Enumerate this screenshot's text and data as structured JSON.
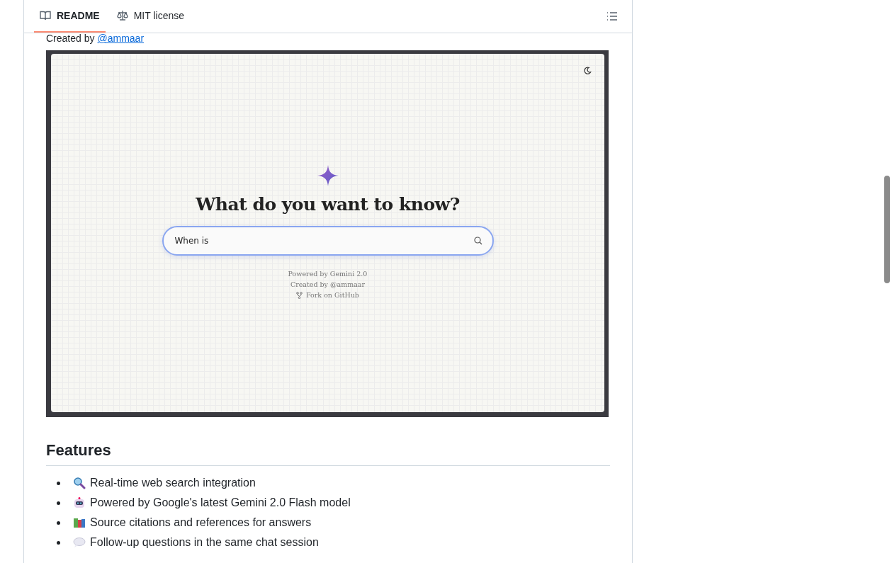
{
  "tabs": [
    {
      "label": "README",
      "selected": true
    },
    {
      "label": "MIT license",
      "selected": false
    }
  ],
  "created_by": {
    "text": "Created by",
    "link": "@ammaar"
  },
  "app_preview": {
    "heading": "What do you want to know?",
    "search_value": "When is",
    "footer": [
      "Powered by Gemini 2.0",
      "Created by @ammaar"
    ],
    "fork_link": "Fork on GitHub"
  },
  "features": {
    "heading": "Features",
    "items": [
      {
        "kind": "search",
        "text": "Real-time web search integration"
      },
      {
        "kind": "robot",
        "text": "Powered by Google's latest Gemini 2.0 Flash model"
      },
      {
        "kind": "books",
        "text": "Source citations and references for answers"
      },
      {
        "kind": "speech",
        "text": "Follow-up questions in the same chat session"
      }
    ]
  }
}
